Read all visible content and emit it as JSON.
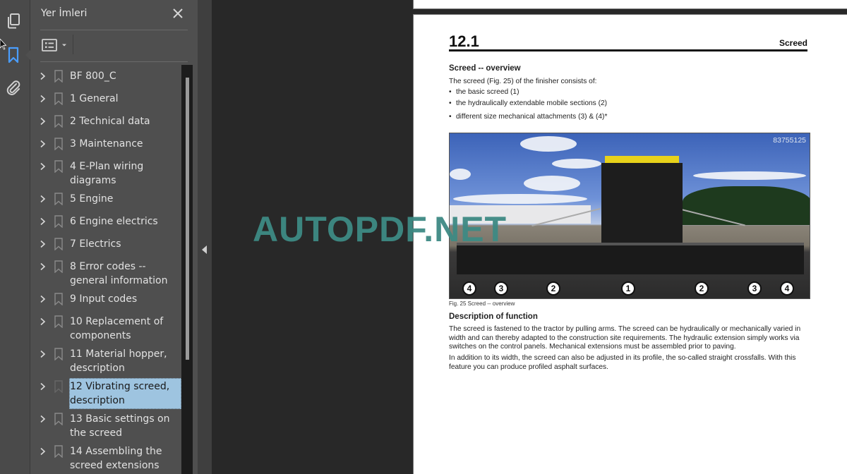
{
  "left_rail": {
    "icons": [
      {
        "name": "pages-thumbnails-icon",
        "active": false
      },
      {
        "name": "bookmarks-icon",
        "active": true
      },
      {
        "name": "attachments-icon",
        "active": false
      }
    ],
    "active_color": "#4a9eff"
  },
  "bookmarks_panel": {
    "title": "Yer İmleri",
    "close_label": "×",
    "view_options_icon": "list-view-icon",
    "items": [
      {
        "label": "BF 800_C",
        "selected": false
      },
      {
        "label": "1 General",
        "selected": false
      },
      {
        "label": "2 Technical data",
        "selected": false
      },
      {
        "label": "3 Maintenance",
        "selected": false
      },
      {
        "label": "4 E-Plan wiring diagrams",
        "selected": false
      },
      {
        "label": "5 Engine",
        "selected": false
      },
      {
        "label": "6 Engine electrics",
        "selected": false
      },
      {
        "label": "7 Electrics",
        "selected": false
      },
      {
        "label": "8 Error codes -- general information",
        "selected": false
      },
      {
        "label": "9 Input codes",
        "selected": false
      },
      {
        "label": "10 Replacement of components",
        "selected": false
      },
      {
        "label": "11 Material hopper, description",
        "selected": false
      },
      {
        "label": "12 Vibrating screed, description",
        "selected": true
      },
      {
        "label": "13 Basic settings on the screed",
        "selected": false
      },
      {
        "label": "14 Assembling the screed extensions",
        "selected": false
      }
    ],
    "selected_color": "#9ec4e0"
  },
  "document": {
    "section_number": "12.1",
    "section_name": "Screed",
    "overview_heading": "Screed -- overview",
    "intro": "The screed (Fig. 25) of the finisher consists of:",
    "bullets": [
      "the basic screed (1)",
      "the hydraulically extendable mobile sections (2)",
      "different size mechanical attachments (3) & (4)*"
    ],
    "figure": {
      "id_label": "83755125",
      "callouts": [
        "4",
        "3",
        "2",
        "1",
        "2",
        "3",
        "4"
      ],
      "caption": "Fig. 25 Screed -- overview"
    },
    "function_heading": "Description of function",
    "paragraphs": [
      "The screed is fastened to the tractor by pulling arms. The screed can be hydraulically or mechanically varied in width and can thereby adapted to the construction site requirements. The hydraulic extension simply works via switches on the control panels. Mechanical extensions must be assembled prior to paving.",
      "In addition to its width, the screed can also be adjusted in its profile, the so-called straight crossfalls. With this feature you can produce profiled asphalt surfaces."
    ]
  },
  "watermark": {
    "text": "AUTOPDF.NET",
    "color": "#3e8a84"
  }
}
